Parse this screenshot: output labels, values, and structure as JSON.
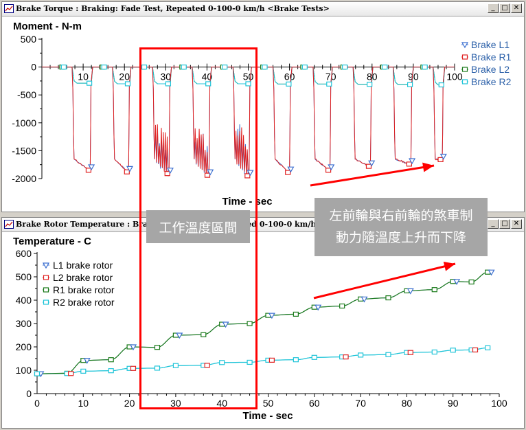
{
  "windows": [
    {
      "title": "Brake Torque : Braking: Fade Test, Repeated 0-100-0 km/h <Brake Tests>"
    },
    {
      "title": "Brake Rotor Temperature : Braking: Fade Test, Repeated 0-100-0 km/h <Brake Tests>"
    }
  ],
  "window_buttons": {
    "minimize": "_",
    "maximize": "□",
    "close": "✕"
  },
  "annotations": {
    "zone_label": "工作溫度區間",
    "note_line1": "左前輪與右前輪的煞車制",
    "note_line2": "動力隨溫度上升而下降"
  },
  "colors": {
    "L1": "#3b6fd0",
    "R1": "#e02020",
    "L2": "#1a7a1a",
    "R2": "#1fc4d8",
    "annotation": "#ff0000",
    "callout": "#a6a6a6"
  },
  "chart_data": [
    {
      "type": "line",
      "ylabel": "Moment - N-m",
      "xlabel": "Time - sec",
      "xlim": [
        0,
        100
      ],
      "ylim": [
        -2000,
        500
      ],
      "x_ticks": [
        10,
        20,
        30,
        40,
        50,
        60,
        70,
        80,
        90,
        100
      ],
      "y_ticks": [
        500,
        0,
        -500,
        -1000,
        -1500,
        -2000
      ],
      "legend_position": "top-right",
      "events": [
        {
          "start": 7.3,
          "end": 12.3,
          "front_peak": -1850,
          "rear_peak": -290
        },
        {
          "start": 17.1,
          "end": 21.6,
          "front_peak": -1880,
          "rear_peak": -300
        },
        {
          "start": 26.8,
          "end": 31.4,
          "front_peak": -1910,
          "rear_peak": -300
        },
        {
          "start": 36.4,
          "end": 41.1,
          "front_peak": -1940,
          "rear_peak": -300
        },
        {
          "start": 46.3,
          "end": 50.8,
          "front_peak": -1950,
          "rear_peak": -300
        },
        {
          "start": 56.0,
          "end": 60.6,
          "front_peak": -1890,
          "rear_peak": -305
        },
        {
          "start": 65.7,
          "end": 70.4,
          "front_peak": -1850,
          "rear_peak": -305
        },
        {
          "start": 75.4,
          "end": 80.2,
          "front_peak": -1780,
          "rear_peak": -310
        },
        {
          "start": 85.1,
          "end": 90.0,
          "front_peak": -1740,
          "rear_peak": -315
        },
        {
          "start": 94.8,
          "end": 97.6,
          "front_peak": -1660,
          "rear_peak": -320
        }
      ],
      "series": [
        {
          "name": "Brake L1",
          "marker": "triangle-down"
        },
        {
          "name": "Brake R1",
          "marker": "square"
        },
        {
          "name": "Brake L2",
          "marker": "square"
        },
        {
          "name": "Brake R2",
          "marker": "square"
        }
      ]
    },
    {
      "type": "line",
      "ylabel": "Temperature - C",
      "xlabel": "Time - sec",
      "xlim": [
        0,
        100
      ],
      "ylim": [
        0,
        600
      ],
      "x_ticks": [
        0,
        10,
        20,
        30,
        40,
        50,
        60,
        70,
        80,
        90,
        100
      ],
      "y_ticks": [
        600,
        500,
        400,
        300,
        200,
        100,
        0
      ],
      "legend_position": "top-left",
      "series": [
        {
          "name": "L1 brake rotor",
          "marker": "triangle-down"
        },
        {
          "name": "L2 brake rotor",
          "marker": "square"
        },
        {
          "name": "R1 brake rotor",
          "marker": "square"
        },
        {
          "name": "R2 brake rotor",
          "marker": "square"
        }
      ],
      "front_rotor": {
        "x": [
          0,
          6.5,
          10,
          16,
          20,
          26,
          30,
          36,
          40,
          46,
          50,
          56,
          60,
          66,
          70,
          76,
          80,
          86,
          90,
          94,
          97.5
        ],
        "y": [
          85,
          87,
          142,
          145,
          200,
          198,
          250,
          252,
          297,
          300,
          335,
          340,
          370,
          375,
          405,
          410,
          440,
          445,
          480,
          478,
          520
        ]
      },
      "rear_rotor": {
        "x": [
          0,
          6.5,
          10,
          16,
          20,
          26,
          30,
          36,
          40,
          46,
          50,
          56,
          60,
          66,
          70,
          76,
          80,
          86,
          90,
          94,
          97.5
        ],
        "y": [
          85,
          86,
          96,
          98,
          108,
          109,
          120,
          121,
          133,
          134,
          143,
          145,
          155,
          157,
          165,
          167,
          176,
          178,
          186,
          187,
          196
        ]
      }
    }
  ]
}
